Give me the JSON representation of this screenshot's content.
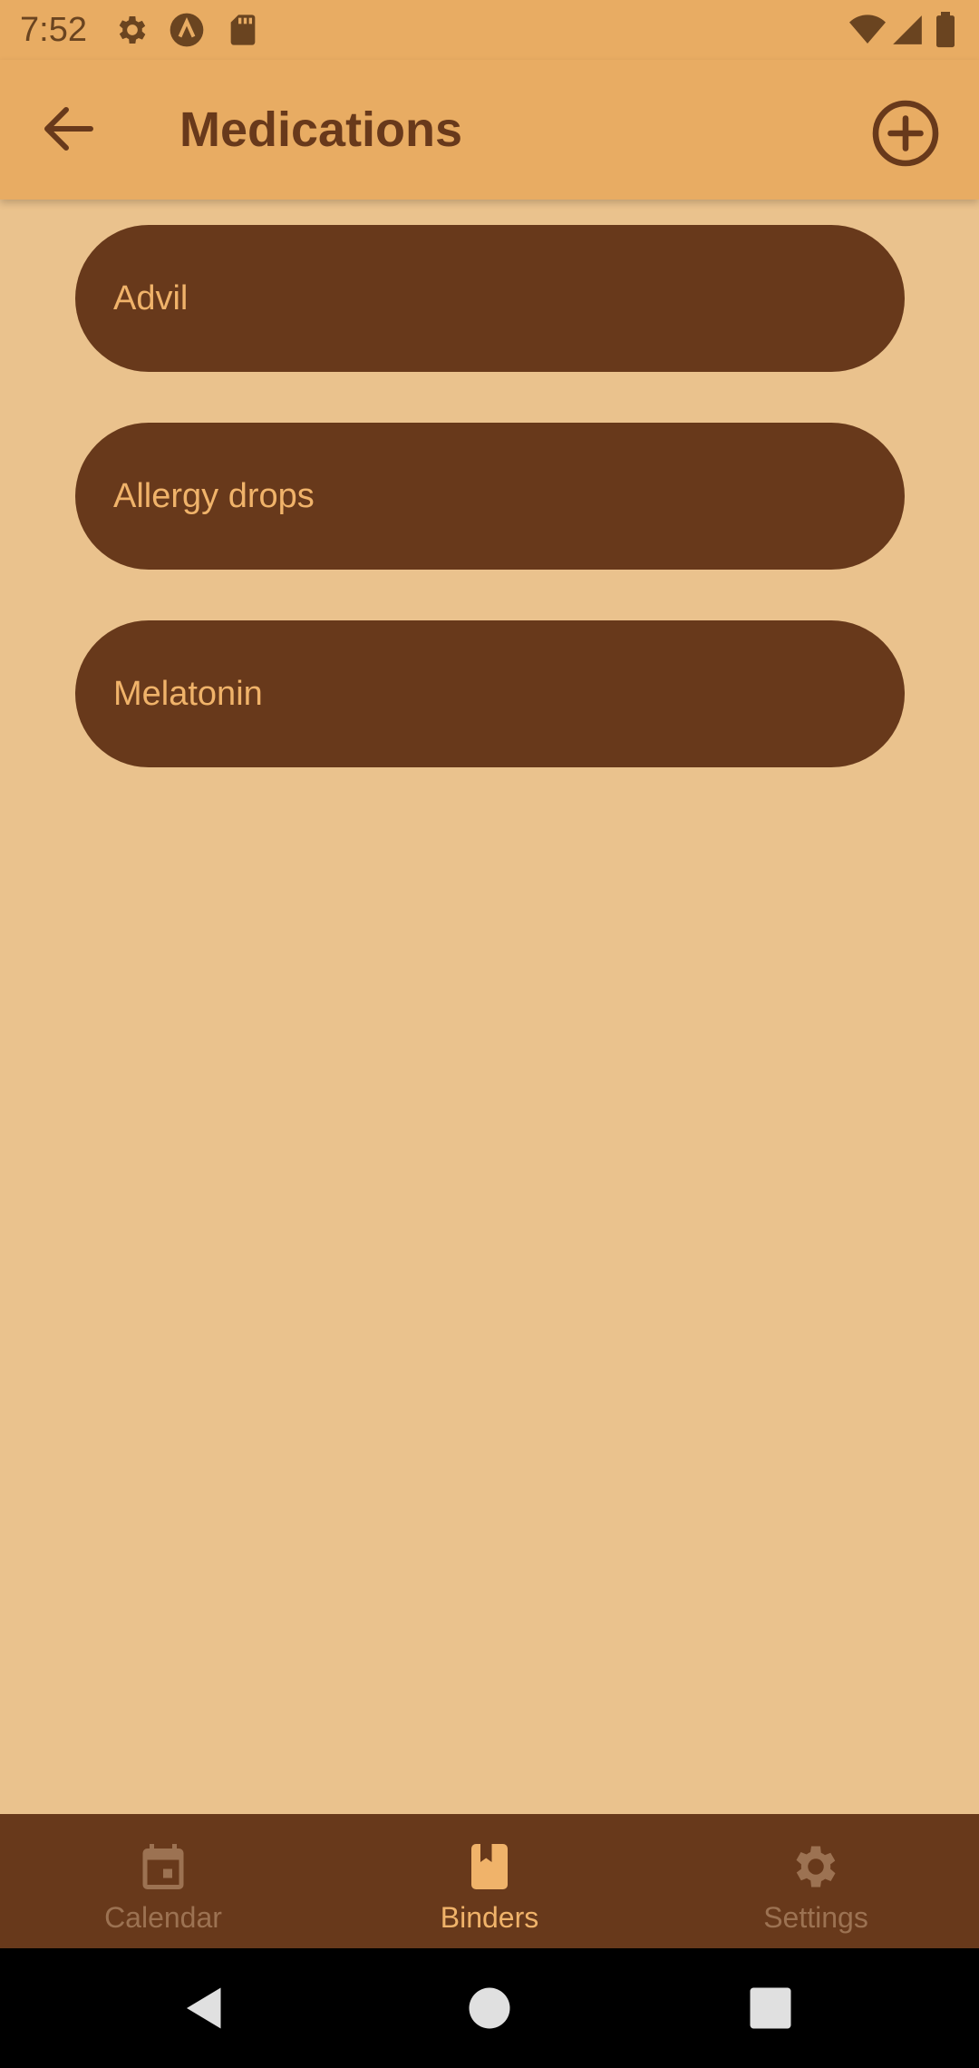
{
  "status_bar": {
    "time": "7:52",
    "left_icons": [
      "gear-icon",
      "a-circle-icon",
      "sd-card-icon"
    ],
    "right_icons": [
      "wifi-icon",
      "signal-icon",
      "battery-icon"
    ]
  },
  "app_bar": {
    "title": "Medications",
    "back_icon": "arrow-back-icon",
    "add_icon": "add-circle-icon"
  },
  "medications": [
    {
      "label": "Advil"
    },
    {
      "label": "Allergy drops"
    },
    {
      "label": "Melatonin"
    }
  ],
  "bottom_nav": {
    "items": [
      {
        "label": "Calendar",
        "icon": "calendar-icon",
        "active": false
      },
      {
        "label": "Binders",
        "icon": "bookmark-book-icon",
        "active": true
      },
      {
        "label": "Settings",
        "icon": "gear-icon",
        "active": false
      }
    ]
  },
  "system_nav": [
    "back-triangle-icon",
    "home-circle-icon",
    "recents-square-icon"
  ],
  "colors": {
    "app_bar": "#E8AC63",
    "background": "#EAC28D",
    "item_fill": "#68391B",
    "item_text": "#F0B36A",
    "nav_inactive": "#9C7252"
  }
}
